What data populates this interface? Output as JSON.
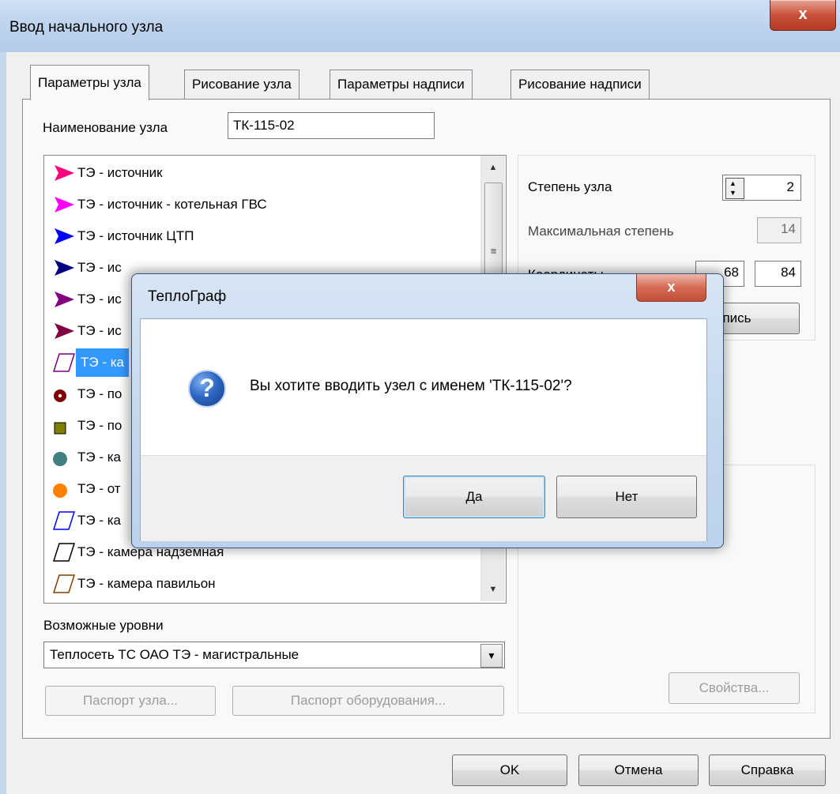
{
  "window": {
    "title": "Ввод начального узла",
    "close_glyph": "x"
  },
  "tabs": [
    {
      "label": "Параметры узла",
      "active": true
    },
    {
      "label": "Рисование узла",
      "active": false
    },
    {
      "label": "Параметры надписи",
      "active": false
    },
    {
      "label": "Рисование надписи",
      "active": false
    }
  ],
  "node_name": {
    "label": "Наименование узла",
    "value": "ТК-115-02"
  },
  "node_types": [
    {
      "label": "ТЭ - источник",
      "icon": "triangle-flag-icon",
      "color": "#ff0080",
      "selected": false
    },
    {
      "label": "ТЭ - источник - котельная ГВС",
      "icon": "triangle-flag-icon",
      "color": "#ff00ff",
      "selected": false
    },
    {
      "label": "ТЭ - источник ЦТП",
      "icon": "triangle-flag-icon",
      "color": "#0000ff",
      "selected": false
    },
    {
      "label": "ТЭ - ис",
      "icon": "triangle-flag-icon",
      "color": "#000080",
      "selected": false
    },
    {
      "label": "ТЭ - ис",
      "icon": "triangle-flag-icon",
      "color": "#800080",
      "selected": false
    },
    {
      "label": "ТЭ - ис",
      "icon": "triangle-flag-icon",
      "color": "#800040",
      "selected": false
    },
    {
      "label": "ТЭ - ка",
      "icon": "parallelogram-icon",
      "color": "#800080",
      "selected": true
    },
    {
      "label": "ТЭ - по",
      "icon": "circle-dot-icon",
      "color": "#800000",
      "selected": false
    },
    {
      "label": "ТЭ - по",
      "icon": "square-icon",
      "color": "#808000",
      "selected": false
    },
    {
      "label": "ТЭ - ка",
      "icon": "circle-icon",
      "color": "#408080",
      "selected": false
    },
    {
      "label": "ТЭ - от",
      "icon": "circle-icon",
      "color": "#ff8000",
      "selected": false
    },
    {
      "label": "ТЭ - ка",
      "icon": "parallelogram-icon",
      "color": "#0000ff",
      "selected": false
    },
    {
      "label": "ТЭ - камера надземная",
      "icon": "parallelogram-icon",
      "color": "#000000",
      "selected": false
    },
    {
      "label": "ТЭ - камера павильон",
      "icon": "parallelogram-icon",
      "color": "#804000",
      "selected": false
    }
  ],
  "levels": {
    "label": "Возможные уровни",
    "value": "Теплосеть ТС ОАО ТЭ - магистральные"
  },
  "buttons": {
    "node_passport": "Паспорт узла...",
    "equipment_passport": "Паспорт оборудования...",
    "properties": "Свойства...",
    "label_btn": "апись",
    "ok": "OK",
    "cancel": "Отмена",
    "help": "Справка"
  },
  "params": {
    "degree_label": "Степень узла",
    "degree_value": "2",
    "max_degree_label": "Максимальная степень",
    "max_degree_value": "14",
    "coords_label": "Координаты",
    "coord1": "68",
    "coord2": "84"
  },
  "message_box": {
    "title": "ТеплоГраф",
    "text": "Вы хотите вводить узел с именем 'ТК-115-02'?",
    "yes": "Да",
    "no": "Нет",
    "icon": "question-icon"
  }
}
